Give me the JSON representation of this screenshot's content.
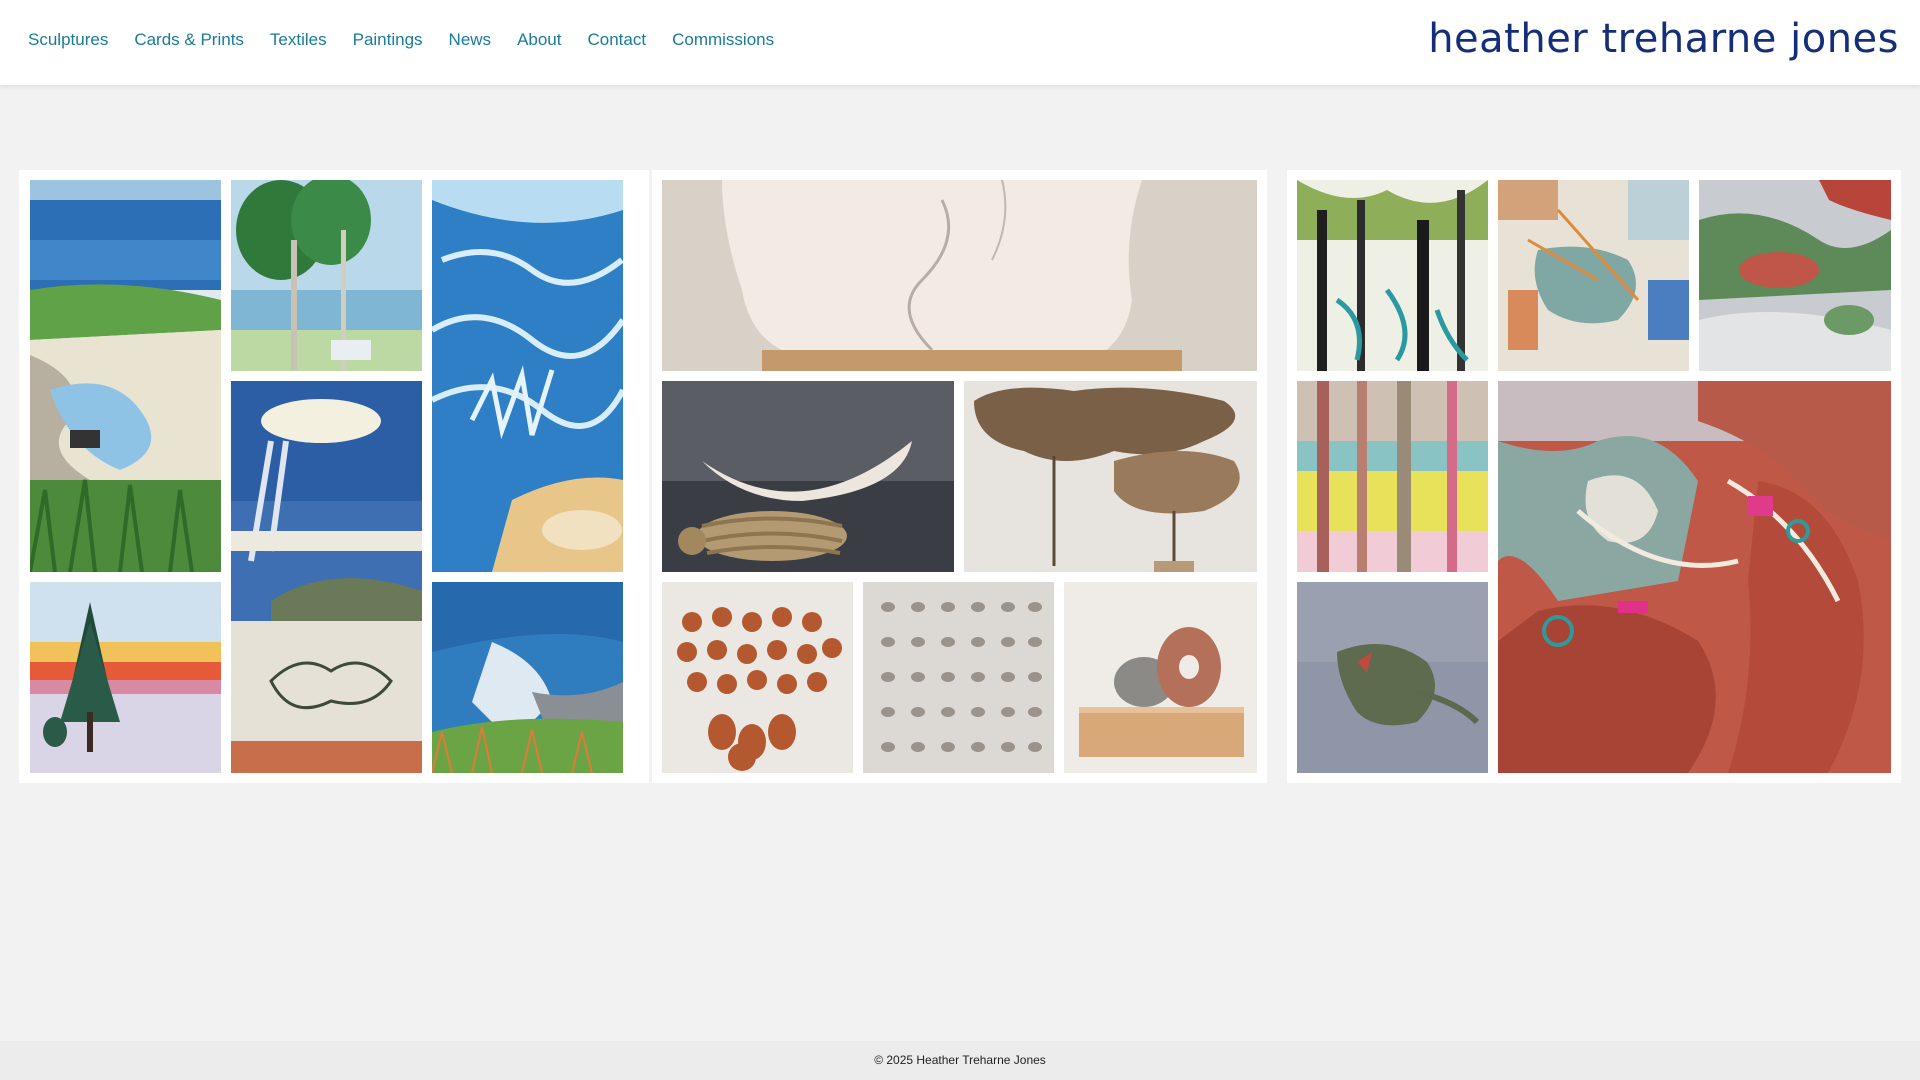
{
  "nav": {
    "items": [
      {
        "label": "Sculptures"
      },
      {
        "label": "Cards & Prints"
      },
      {
        "label": "Textiles"
      },
      {
        "label": "Paintings"
      },
      {
        "label": "News"
      },
      {
        "label": "About"
      },
      {
        "label": "Contact"
      },
      {
        "label": "Commissions"
      }
    ]
  },
  "brand": {
    "name": "heather treharne jones"
  },
  "gallery": {
    "panels": [
      {
        "category": "Cards & Prints",
        "tiles": [
          "coastal-rocks-print",
          "pine-trees-sea-print",
          "wave-pattern-print",
          "sun-cloud-beach-print",
          "winter-tree-sunset-print",
          "ocean-cliff-print"
        ]
      },
      {
        "category": "Sculptures",
        "tiles": [
          "white-marble-sculpture",
          "stone-on-rope-sculpture",
          "driftwood-stand-sculpture",
          "terracotta-pots-sculpture",
          "shell-grid-sculpture",
          "stone-on-wood-sculpture"
        ]
      },
      {
        "category": "Paintings",
        "tiles": [
          "palm-trees-painting",
          "abstract-bird-painting",
          "abstract-red-green-painting",
          "forest-colour-painting",
          "bird-grey-painting",
          "large-red-abstract-painting"
        ]
      }
    ]
  },
  "colors": {
    "nav_link": "#1a7a9a",
    "brand": "#142e7a",
    "background": "#f2f2f2"
  },
  "footer": {
    "copyright": "© 2025 Heather Treharne Jones"
  }
}
